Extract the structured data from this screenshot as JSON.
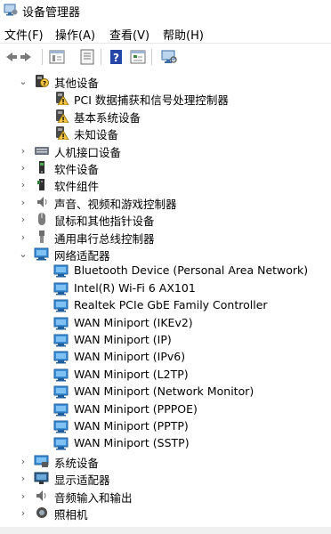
{
  "window": {
    "title": "设备管理器"
  },
  "menu": [
    "文件(F)",
    "操作(A)",
    "查看(V)",
    "帮助(H)"
  ],
  "toolbar": [
    "back-icon",
    "forward-icon",
    "properties-icon",
    "update-driver-icon",
    "help-icon",
    "view-icon",
    "scan-icon"
  ],
  "tree": [
    {
      "label": "其他设备",
      "level": 0,
      "expanded": true,
      "icon": "other-devices-icon"
    },
    {
      "label": "PCI 数据捕获和信号处理控制器",
      "level": 1,
      "icon": "warning-device-icon"
    },
    {
      "label": "基本系统设备",
      "level": 1,
      "icon": "warning-device-icon"
    },
    {
      "label": "未知设备",
      "level": 1,
      "icon": "warning-device-icon"
    },
    {
      "label": "人机接口设备",
      "level": 0,
      "expanded": false,
      "icon": "hid-icon"
    },
    {
      "label": "软件设备",
      "level": 0,
      "expanded": false,
      "icon": "software-device-icon"
    },
    {
      "label": "软件组件",
      "level": 0,
      "expanded": false,
      "icon": "software-component-icon"
    },
    {
      "label": "声音、视频和游戏控制器",
      "level": 0,
      "expanded": false,
      "icon": "sound-icon"
    },
    {
      "label": "鼠标和其他指针设备",
      "level": 0,
      "expanded": false,
      "icon": "mouse-icon"
    },
    {
      "label": "通用串行总线控制器",
      "level": 0,
      "expanded": false,
      "icon": "usb-icon"
    },
    {
      "label": "网络适配器",
      "level": 0,
      "expanded": true,
      "icon": "network-adapter-icon"
    },
    {
      "label": "Bluetooth Device (Personal Area Network)",
      "level": 1,
      "icon": "network-adapter-icon"
    },
    {
      "label": "Intel(R) Wi-Fi 6 AX101",
      "level": 1,
      "icon": "network-adapter-icon"
    },
    {
      "label": "Realtek PCIe GbE Family Controller",
      "level": 1,
      "icon": "network-adapter-icon"
    },
    {
      "label": "WAN Miniport (IKEv2)",
      "level": 1,
      "icon": "network-adapter-icon"
    },
    {
      "label": "WAN Miniport (IP)",
      "level": 1,
      "icon": "network-adapter-icon"
    },
    {
      "label": "WAN Miniport (IPv6)",
      "level": 1,
      "icon": "network-adapter-icon"
    },
    {
      "label": "WAN Miniport (L2TP)",
      "level": 1,
      "icon": "network-adapter-icon"
    },
    {
      "label": "WAN Miniport (Network Monitor)",
      "level": 1,
      "icon": "network-adapter-icon"
    },
    {
      "label": "WAN Miniport (PPPOE)",
      "level": 1,
      "icon": "network-adapter-icon"
    },
    {
      "label": "WAN Miniport (PPTP)",
      "level": 1,
      "icon": "network-adapter-icon"
    },
    {
      "label": "WAN Miniport (SSTP)",
      "level": 1,
      "icon": "network-adapter-icon"
    },
    {
      "label": "系统设备",
      "level": 0,
      "expanded": false,
      "icon": "system-device-icon"
    },
    {
      "label": "显示适配器",
      "level": 0,
      "expanded": false,
      "icon": "display-adapter-icon"
    },
    {
      "label": "音频输入和输出",
      "level": 0,
      "expanded": false,
      "icon": "audio-io-icon"
    },
    {
      "label": "照相机",
      "level": 0,
      "expanded": false,
      "icon": "camera-icon"
    }
  ]
}
